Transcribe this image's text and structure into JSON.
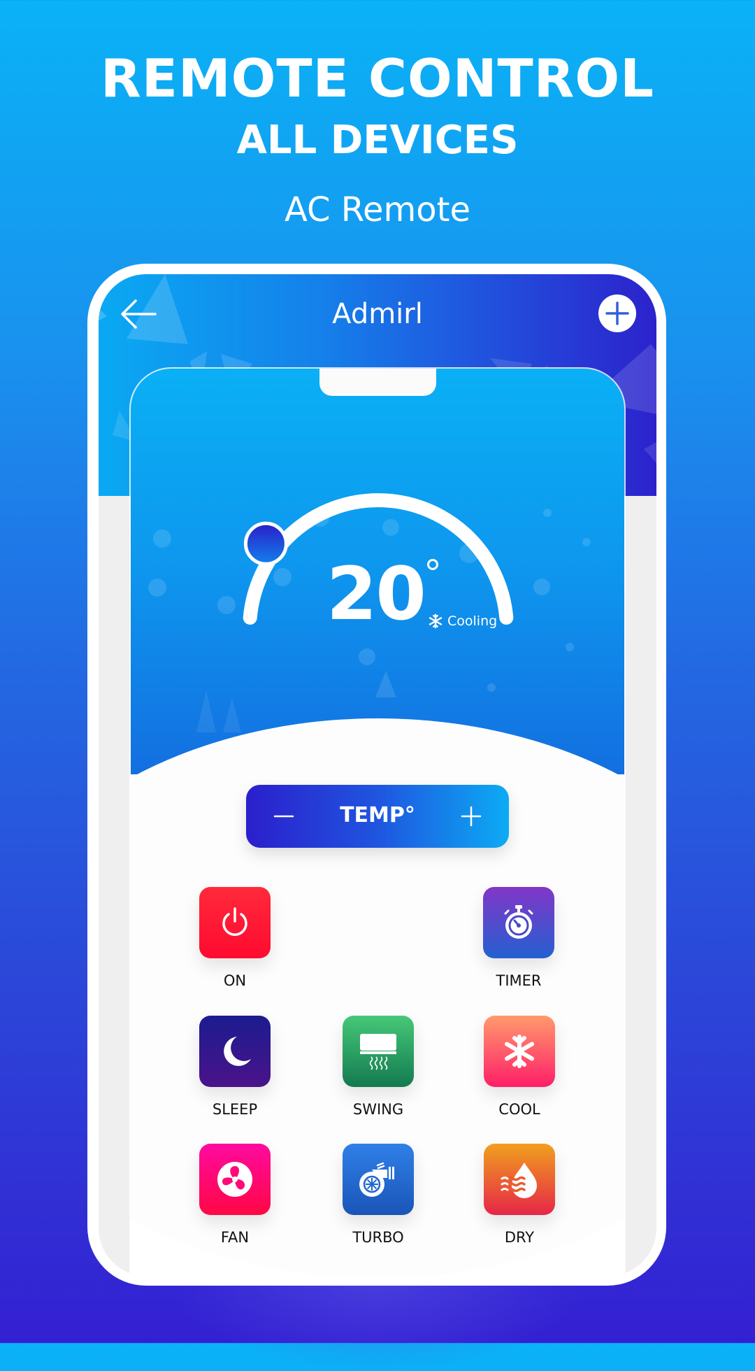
{
  "promo": {
    "headline": "REMOTE CONTROL",
    "subheadline": "ALL DEVICES",
    "caption": "AC Remote"
  },
  "app": {
    "title": "Admirl",
    "back_icon": "arrow-left-icon",
    "add_icon": "plus-icon"
  },
  "thermostat": {
    "temperature": "20",
    "unit_symbol": "°",
    "mode_label": "Cooling",
    "mode_icon": "snowflake-icon",
    "dial_fraction": 0.18
  },
  "temp_control": {
    "label": "TEMP°",
    "decrease_icon": "minus-icon",
    "increase_icon": "plus-icon"
  },
  "buttons": [
    {
      "label": "ON",
      "icon": "power-icon",
      "colors": [
        "#ff2a3a",
        "#ff0a30"
      ]
    },
    {
      "label": "TIMER",
      "icon": "stopwatch-icon",
      "colors": [
        "#8236c8",
        "#2460d0"
      ]
    },
    {
      "label": "SLEEP",
      "icon": "moon-icon",
      "colors": [
        "#1b1c8f",
        "#4b138a"
      ]
    },
    {
      "label": "SWING",
      "icon": "air-conditioner-icon",
      "colors": [
        "#46c878",
        "#137a50"
      ]
    },
    {
      "label": "COOL",
      "icon": "snowflake-icon",
      "colors": [
        "#ff9a6c",
        "#ff1f68"
      ]
    },
    {
      "label": "FAN",
      "icon": "fan-icon",
      "colors": [
        "#ff0aa0",
        "#ff0845"
      ]
    },
    {
      "label": "TURBO",
      "icon": "turbo-icon",
      "colors": [
        "#2f80e8",
        "#1a55b8"
      ]
    },
    {
      "label": "DRY",
      "icon": "humidity-drop-icon",
      "colors": [
        "#f0a01e",
        "#e62648"
      ]
    }
  ]
}
